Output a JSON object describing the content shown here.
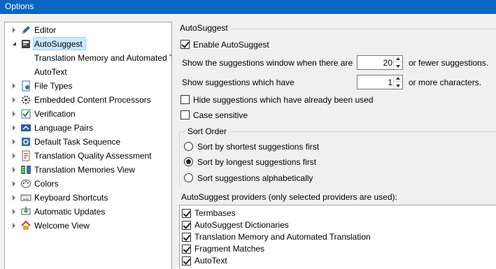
{
  "window": {
    "title": "Options"
  },
  "tree": {
    "items": [
      {
        "label": "Editor",
        "icon": "pencil-icon",
        "expander": "collapsed",
        "indent": 0
      },
      {
        "label": "AutoSuggest",
        "icon": "autosuggest-icon",
        "expander": "expanded",
        "indent": 0,
        "selected": true
      },
      {
        "label": "Translation Memory and Automated Tr",
        "icon": "",
        "expander": "",
        "indent": 1
      },
      {
        "label": "AutoText",
        "icon": "",
        "expander": "",
        "indent": 1
      },
      {
        "label": "File Types",
        "icon": "file-types-icon",
        "expander": "collapsed",
        "indent": 0
      },
      {
        "label": "Embedded Content Processors",
        "icon": "gear-icon",
        "expander": "collapsed",
        "indent": 0
      },
      {
        "label": "Verification",
        "icon": "verification-icon",
        "expander": "collapsed",
        "indent": 0
      },
      {
        "label": "Language Pairs",
        "icon": "language-pairs-icon",
        "expander": "collapsed",
        "indent": 0
      },
      {
        "label": "Default Task Sequence",
        "icon": "task-sequence-icon",
        "expander": "collapsed",
        "indent": 0
      },
      {
        "label": "Translation Quality Assessment",
        "icon": "quality-assessment-icon",
        "expander": "collapsed",
        "indent": 0
      },
      {
        "label": "Translation Memories View",
        "icon": "tm-view-icon",
        "expander": "collapsed",
        "indent": 0
      },
      {
        "label": "Colors",
        "icon": "palette-icon",
        "expander": "collapsed",
        "indent": 0
      },
      {
        "label": "Keyboard Shortcuts",
        "icon": "keyboard-icon",
        "expander": "collapsed",
        "indent": 0
      },
      {
        "label": "Automatic Updates",
        "icon": "updates-icon",
        "expander": "collapsed",
        "indent": 0
      },
      {
        "label": "Welcome View",
        "icon": "home-icon",
        "expander": "collapsed",
        "indent": 0
      }
    ]
  },
  "panel": {
    "title": "AutoSuggest",
    "enable": {
      "label": "Enable AutoSuggest",
      "checked": true
    },
    "window_row": {
      "prefix": "Show the suggestions window when there are",
      "value": "20",
      "suffix": "or fewer suggestions."
    },
    "chars_row": {
      "prefix": "Show suggestions which have",
      "value": "1",
      "suffix": "or more characters."
    },
    "hide_used": {
      "label": "Hide suggestions which have already been used",
      "checked": false
    },
    "case_sensitive": {
      "label": "Case sensitive",
      "checked": false
    },
    "sort_order": {
      "title": "Sort Order",
      "options": [
        {
          "label": "Sort by shortest suggestions first",
          "selected": false
        },
        {
          "label": "Sort by longest suggestions first",
          "selected": true
        },
        {
          "label": "Sort suggestions alphabetically",
          "selected": false
        }
      ]
    },
    "providers": {
      "title": "AutoSuggest providers (only selected providers are used):",
      "items": [
        {
          "label": "Termbases",
          "checked": true
        },
        {
          "label": "AutoSuggest Dictionaries",
          "checked": true
        },
        {
          "label": "Translation Memory and Automated Translation",
          "checked": true
        },
        {
          "label": "Fragment Matches",
          "checked": true
        },
        {
          "label": "AutoText",
          "checked": true
        }
      ]
    }
  }
}
